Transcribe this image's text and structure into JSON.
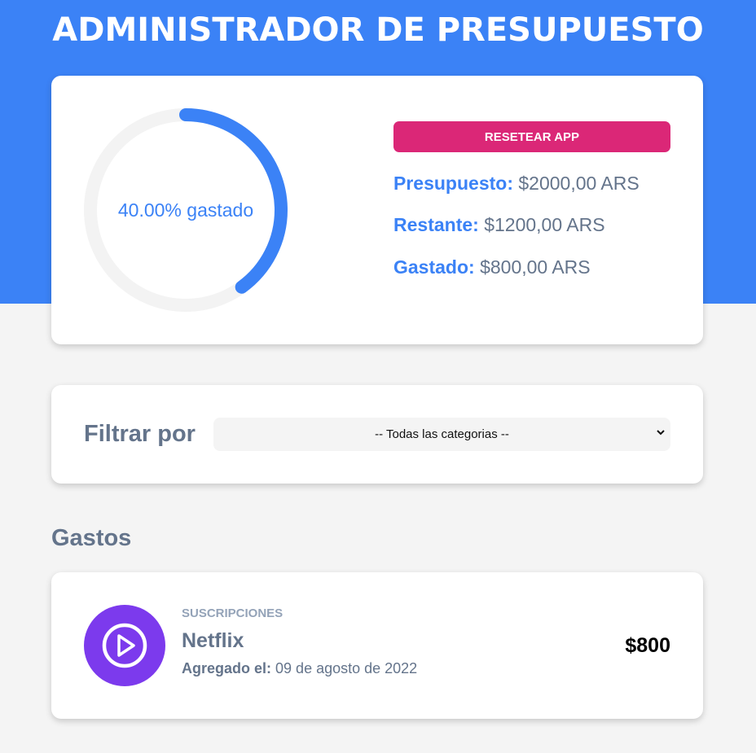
{
  "header": {
    "title": "ADMINISTRADOR DE PRESUPUESTO"
  },
  "budget": {
    "spent_fraction": 0.4,
    "progress_label": "40.00% gastado",
    "reset_button": "RESETEAR APP",
    "presupuesto_label": "Presupuesto:",
    "presupuesto_value": "$2000,00 ARS",
    "restante_label": "Restante:",
    "restante_value": "$1200,00 ARS",
    "gastado_label": "Gastado:",
    "gastado_value": "$800,00 ARS"
  },
  "filter": {
    "label": "Filtrar por",
    "selected": "-- Todas las categorias --"
  },
  "gastos": {
    "title": "Gastos",
    "items": [
      {
        "category": "SUSCRIPCIONES",
        "name": "Netflix",
        "date_label": "Agregado el:",
        "date": "09 de agosto de 2022",
        "amount": "$800",
        "icon": "play-icon"
      }
    ]
  },
  "colors": {
    "primary": "#3b82f6",
    "reset": "#db2777",
    "subscription_icon": "#7c3aed",
    "background": "#f4f4f4",
    "track": "#f3f3f3"
  }
}
